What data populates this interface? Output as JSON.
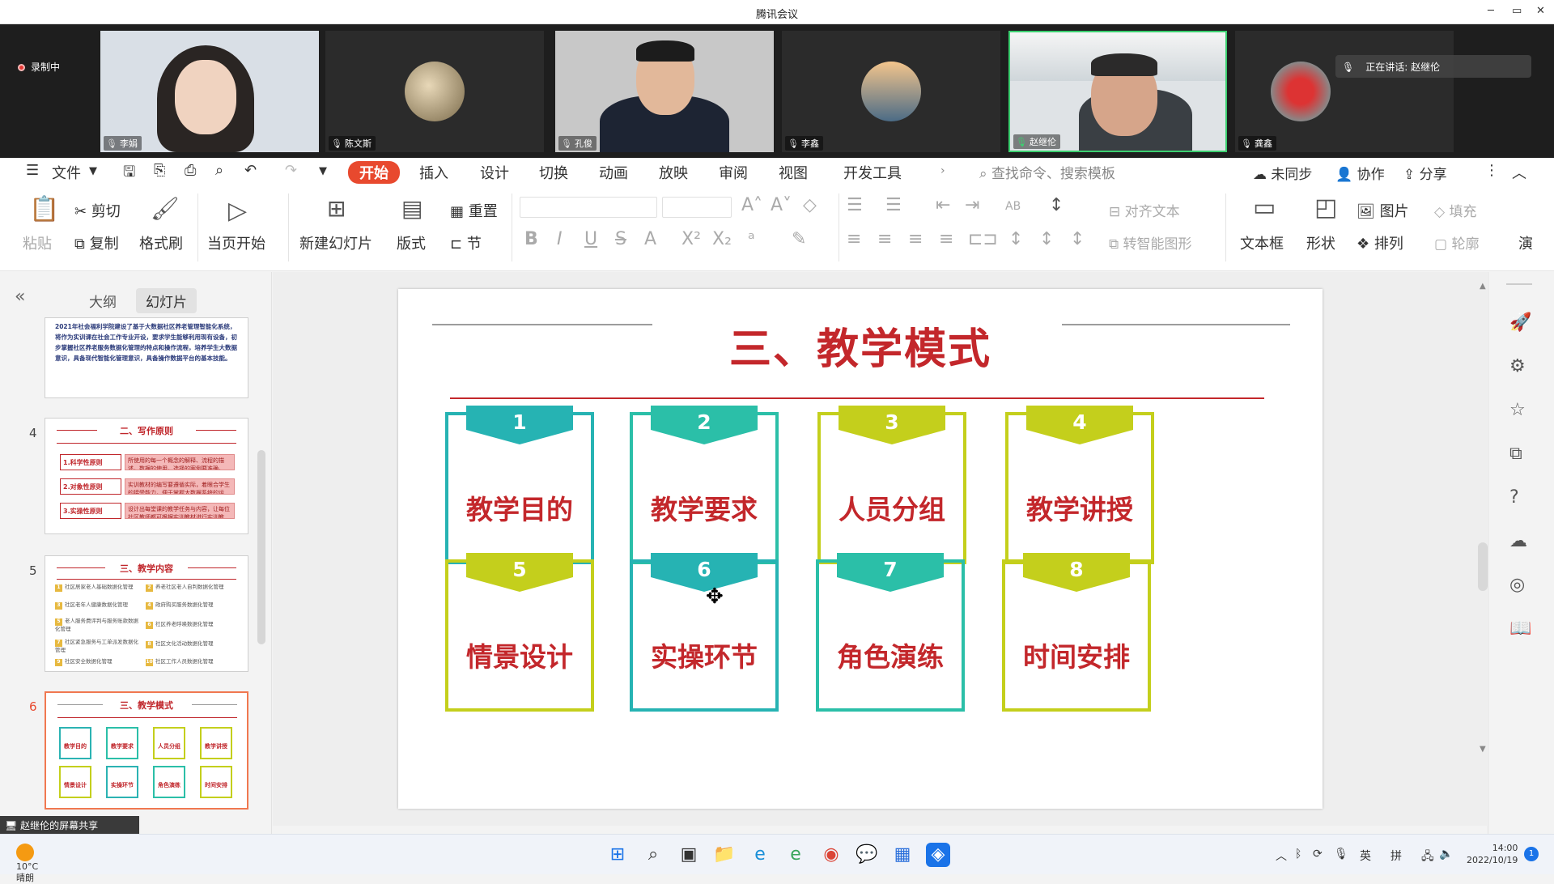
{
  "window": {
    "title": "腾讯会议",
    "min": "─",
    "max": "▭",
    "close": "✕"
  },
  "meeting": {
    "recording": "录制中",
    "speaking_label": "正在讲话: 赵继伦",
    "participants": [
      {
        "name": "李娟"
      },
      {
        "name": "陈文斯"
      },
      {
        "name": "孔俊"
      },
      {
        "name": "李鑫"
      },
      {
        "name": "赵继伦"
      },
      {
        "name": "龚鑫"
      }
    ],
    "share_label": "赵继伦的屏幕共享"
  },
  "wps": {
    "file_menu": "文件",
    "tabs": [
      "开始",
      "插入",
      "设计",
      "切换",
      "动画",
      "放映",
      "审阅",
      "视图",
      "开发工具"
    ],
    "search": "查找命令、搜索模板",
    "right": {
      "sync": "未同步",
      "collab": "协作",
      "share": "分享"
    },
    "ribbon": {
      "paste": "粘贴",
      "cut": "剪切",
      "copy": "复制",
      "format_painter": "格式刷",
      "play_current": "当页开始",
      "new_slide": "新建幻灯片",
      "layout": "版式",
      "reset": "重置",
      "section": "节",
      "align_text": "对齐文本",
      "smart_shape": "转智能图形",
      "textbox": "文本框",
      "shape": "形状",
      "image": "图片",
      "arrange": "排列",
      "fill": "填充",
      "outline": "轮廓",
      "more": "演"
    }
  },
  "panel": {
    "tab_outline": "大纲",
    "tab_slides": "幻灯片"
  },
  "thumbs": {
    "t3_text": "2021年社会福利学院建设了基于大数据社区养老管理智能化系统，将作为实训课在社会工作专业开设，要求学生能够利用现有设备，初步掌握社区养老服务数据化管理的特点和操作流程，培养学生大数据意识，具备现代智能化管理意识，具备操作数据平台的基本技能。",
    "t4": {
      "num": "4",
      "title": "二、写作原则",
      "rows": [
        {
          "label": "1.科学性原则",
          "text": "所使用的每一个概念的解释、流程的描述，数据的使用，选择的案例要准确。"
        },
        {
          "label": "2.对象性原则",
          "text": "实训教材的编写要遵循实际，着眼合学生的接受能力，便于掌握大数据系统的运用。"
        },
        {
          "label": "3.实操性原则",
          "text": "设计出每堂课的教学任务与内容，让每位社区教师都可根据实训教材进行实训教学。"
        }
      ]
    },
    "t5": {
      "num": "5",
      "title": "三、教学内容",
      "items": [
        {
          "n": "1",
          "t": "社区居家老人基础数据化管理"
        },
        {
          "n": "2",
          "t": "养老社区老人自判数据化管理"
        },
        {
          "n": "3",
          "t": "社区老年人健康数据化管理"
        },
        {
          "n": "4",
          "t": "政府购买服务数据化管理"
        },
        {
          "n": "5",
          "t": "老人服务费评判与服务账款数据化管理"
        },
        {
          "n": "6",
          "t": "社区养老呼唤数据化管理"
        },
        {
          "n": "7",
          "t": "社区紧急服务与工单派发数据化管理"
        },
        {
          "n": "8",
          "t": "社区文化活动数据化管理"
        },
        {
          "n": "9",
          "t": "社区安全数据化管理"
        },
        {
          "n": "10",
          "t": "社区工作人员数据化管理"
        }
      ]
    },
    "t6": {
      "num": "6",
      "title": "三、教学模式"
    }
  },
  "slide": {
    "title": "三、教学模式",
    "cards": [
      {
        "n": "1",
        "label": "教学目的",
        "color": "#26b3b3"
      },
      {
        "n": "2",
        "label": "教学要求",
        "color": "#2bbfa8"
      },
      {
        "n": "3",
        "label": "人员分组",
        "color": "#c4cf1c"
      },
      {
        "n": "4",
        "label": "教学讲授",
        "color": "#c4cf1c"
      },
      {
        "n": "5",
        "label": "情景设计",
        "color": "#c4cf1c"
      },
      {
        "n": "6",
        "label": "实操环节",
        "color": "#26b3b3"
      },
      {
        "n": "7",
        "label": "角色演练",
        "color": "#2bbfa8"
      },
      {
        "n": "8",
        "label": "时间安排",
        "color": "#c4cf1c"
      }
    ]
  },
  "taskbar": {
    "temp": "10°C",
    "weather": "晴朗",
    "ime_lang": "英",
    "ime_mode": "拼",
    "time": "14:00",
    "date": "2022/10/19",
    "notifications": "1"
  }
}
